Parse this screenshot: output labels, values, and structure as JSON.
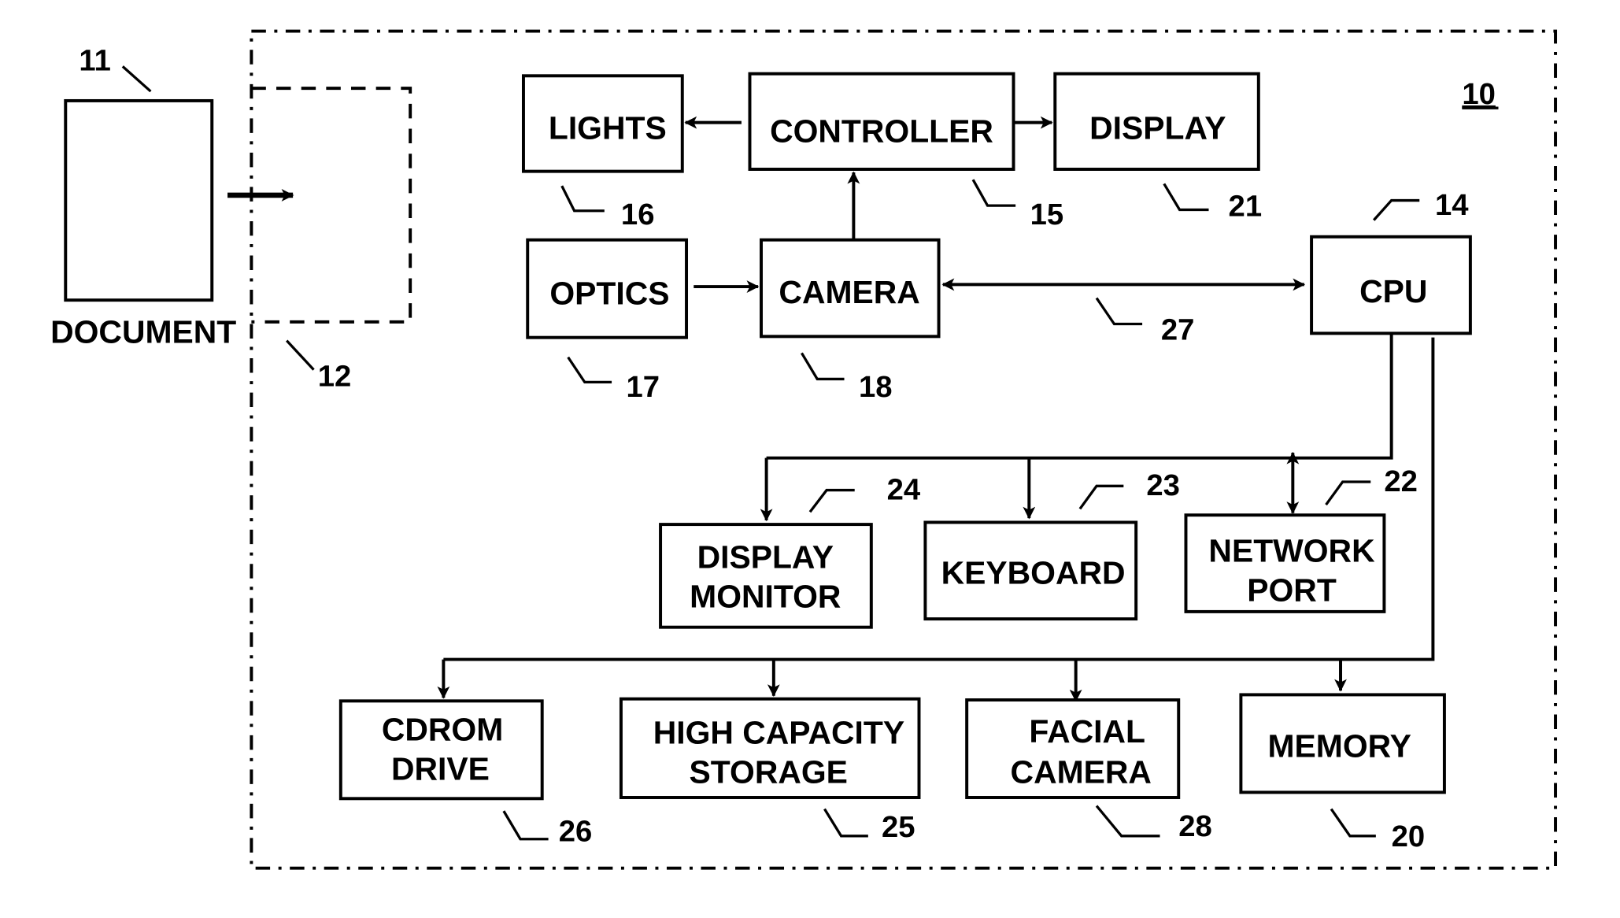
{
  "figure": {
    "system_ref": "10",
    "document": {
      "label": "DOCUMENT",
      "ref": "11"
    },
    "scan_area": {
      "ref": "12"
    },
    "blocks": [
      {
        "id": "lights",
        "lines": [
          "LIGHTS"
        ],
        "ref": "16"
      },
      {
        "id": "controller",
        "lines": [
          "CONTROLLER"
        ],
        "ref": "15"
      },
      {
        "id": "display",
        "lines": [
          "DISPLAY"
        ],
        "ref": "21"
      },
      {
        "id": "optics",
        "lines": [
          "OPTICS"
        ],
        "ref": "17"
      },
      {
        "id": "camera",
        "lines": [
          "CAMERA"
        ],
        "ref": "18"
      },
      {
        "id": "cpu",
        "lines": [
          "CPU"
        ],
        "ref": "14"
      },
      {
        "id": "display-monitor",
        "lines": [
          "DISPLAY",
          "MONITOR"
        ],
        "ref": "24"
      },
      {
        "id": "keyboard",
        "lines": [
          "KEYBOARD"
        ],
        "ref": "23"
      },
      {
        "id": "network-port",
        "lines": [
          "NETWORK",
          "PORT"
        ],
        "ref": "22"
      },
      {
        "id": "cdrom-drive",
        "lines": [
          "CDROM",
          "DRIVE"
        ],
        "ref": "26"
      },
      {
        "id": "high-capacity-storage",
        "lines": [
          "HIGH CAPACITY",
          "STORAGE"
        ],
        "ref": "25"
      },
      {
        "id": "facial-camera",
        "lines": [
          "FACIAL",
          "CAMERA"
        ],
        "ref": "28"
      },
      {
        "id": "memory",
        "lines": [
          "MEMORY"
        ],
        "ref": "20"
      }
    ],
    "bus_ref": "27",
    "connections": [
      {
        "from": "document",
        "to": "scan_area",
        "type": "arrow"
      },
      {
        "from": "controller",
        "to": "lights",
        "type": "arrow"
      },
      {
        "from": "controller",
        "to": "display",
        "type": "arrow"
      },
      {
        "from": "camera",
        "to": "controller",
        "type": "arrow"
      },
      {
        "from": "optics",
        "to": "camera",
        "type": "arrow"
      },
      {
        "from": "camera",
        "to": "cpu",
        "type": "bidirectional"
      },
      {
        "from": "cpu",
        "to": "display-monitor",
        "type": "arrow"
      },
      {
        "from": "cpu",
        "to": "keyboard",
        "type": "arrow"
      },
      {
        "from": "cpu",
        "to": "network-port",
        "type": "bidirectional"
      },
      {
        "from": "cpu",
        "to": "cdrom-drive",
        "type": "arrow"
      },
      {
        "from": "cpu",
        "to": "high-capacity-storage",
        "type": "arrow"
      },
      {
        "from": "cpu",
        "to": "facial-camera",
        "type": "arrow"
      },
      {
        "from": "cpu",
        "to": "memory",
        "type": "arrow"
      }
    ]
  }
}
